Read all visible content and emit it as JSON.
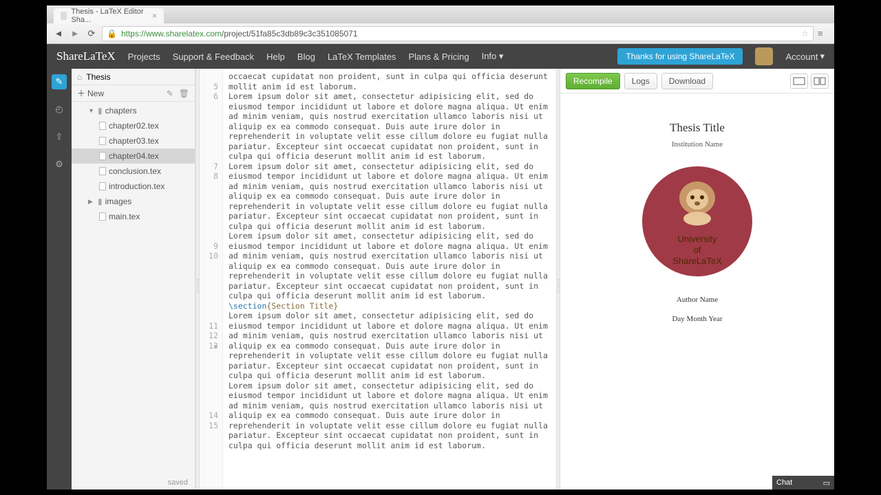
{
  "browser": {
    "tab_title": "Thesis - LaTeX Editor Sha...",
    "url_host": "https://www.sharelatex.com",
    "url_path": "/project/51fa85c3db89c3c351085071"
  },
  "header": {
    "logo": "ShareLaTeX",
    "nav": [
      "Projects",
      "Support & Feedback",
      "Help",
      "Blog",
      "LaTeX Templates",
      "Plans & Pricing",
      "Info"
    ],
    "thanks": "Thanks for using ShareLaTeX",
    "account": "Account"
  },
  "tree": {
    "root": "Thesis",
    "new_label": "New",
    "items": [
      {
        "type": "folder",
        "name": "chapters",
        "expanded": true,
        "children": [
          {
            "type": "file",
            "name": "chapter02.tex"
          },
          {
            "type": "file",
            "name": "chapter03.tex"
          },
          {
            "type": "file",
            "name": "chapter04.tex",
            "selected": true
          },
          {
            "type": "file",
            "name": "conclusion.tex"
          },
          {
            "type": "file",
            "name": "introduction.tex"
          }
        ]
      },
      {
        "type": "folder",
        "name": "images",
        "expanded": false
      },
      {
        "type": "file",
        "name": "main.tex"
      }
    ],
    "status": "saved"
  },
  "editor": {
    "lorem": "Lorem ipsum dolor sit amet, consectetur adipisicing elit, sed do eiusmod tempor incididunt ut labore et dolore magna aliqua. Ut enim ad minim veniam, quis nostrud exercitation ullamco laboris nisi ut aliquip ex ea commodo consequat. Duis aute irure dolor in reprehenderit in voluptate velit esse cillum dolore eu fugiat nulla pariatur. Excepteur sint occaecat cupidatat non proident, sunt in culpa qui officia deserunt mollit anim id est laborum.",
    "partial_top": "occaecat cupidatat non proident, sunt in culpa qui officia deserunt mollit anim id est laborum.",
    "section_cmd": "\\section",
    "section_arg": "{Section Title}",
    "line_numbers": [
      "",
      "5",
      "6",
      "",
      "",
      "",
      "",
      "",
      "",
      "7",
      "8",
      "",
      "",
      "",
      "",
      "",
      "",
      "9",
      "10",
      "",
      "",
      "",
      "",
      "",
      "",
      "11",
      "12",
      "13",
      "",
      "",
      "",
      "",
      "",
      "",
      "14",
      "15"
    ]
  },
  "preview": {
    "recompile": "Recompile",
    "logs": "Logs",
    "download": "Download",
    "doc": {
      "title": "Thesis Title",
      "institution": "Institution Name",
      "university_lines": [
        "University",
        "of",
        "ShareLaTeX"
      ],
      "author": "Author Name",
      "date": "Day Month Year"
    }
  },
  "chat": {
    "label": "Chat"
  }
}
